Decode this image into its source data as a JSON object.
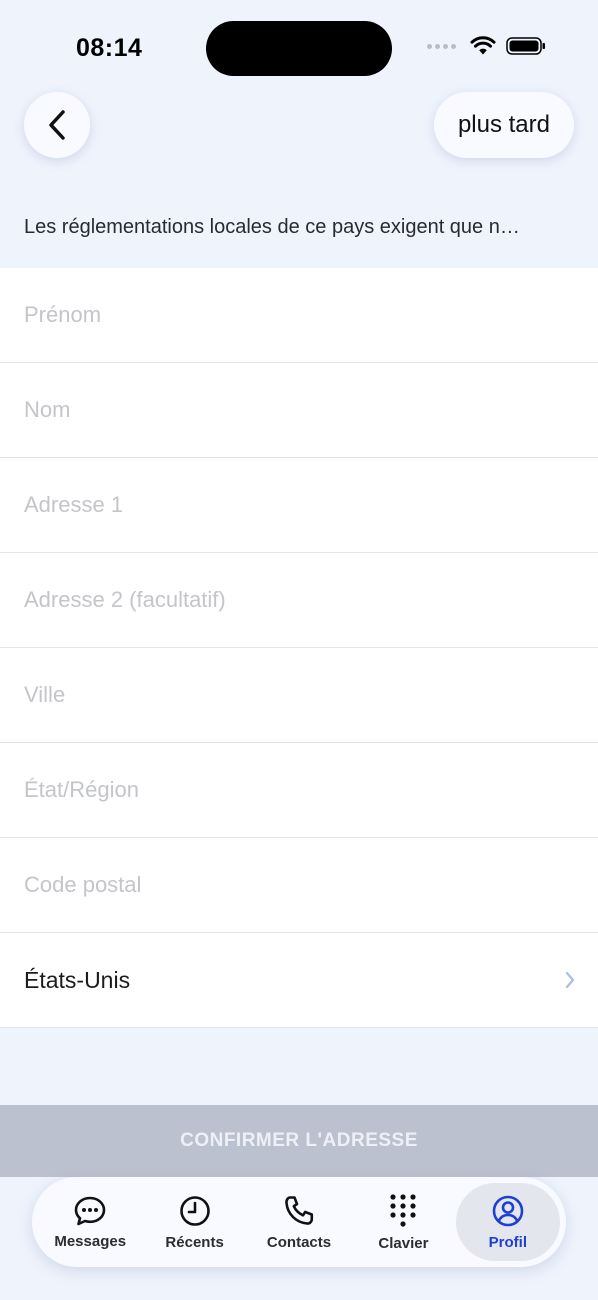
{
  "status_bar": {
    "time": "08:14"
  },
  "header": {
    "later_label": "plus tard"
  },
  "notice": "Les réglementations locales de ce pays exigent que n…",
  "form": {
    "first_name_placeholder": "Prénom",
    "last_name_placeholder": "Nom",
    "address1_placeholder": "Adresse 1",
    "address2_placeholder": "Adresse 2 (facultatif)",
    "city_placeholder": "Ville",
    "state_placeholder": "État/Région",
    "postal_placeholder": "Code postal",
    "country_value": "États-Unis"
  },
  "confirm_label": "CONFIRMER L'ADRESSE",
  "tabs": [
    {
      "label": "Messages",
      "icon": "chat-bubble-icon"
    },
    {
      "label": "Récents",
      "icon": "clock-icon"
    },
    {
      "label": "Contacts",
      "icon": "phone-icon"
    },
    {
      "label": "Clavier",
      "icon": "keypad-icon"
    },
    {
      "label": "Profil",
      "icon": "profile-icon",
      "active": true
    }
  ],
  "colors": {
    "background": "#eef3fc",
    "accent": "#1f3fd3",
    "button_disabled": "#bcc1d0"
  }
}
